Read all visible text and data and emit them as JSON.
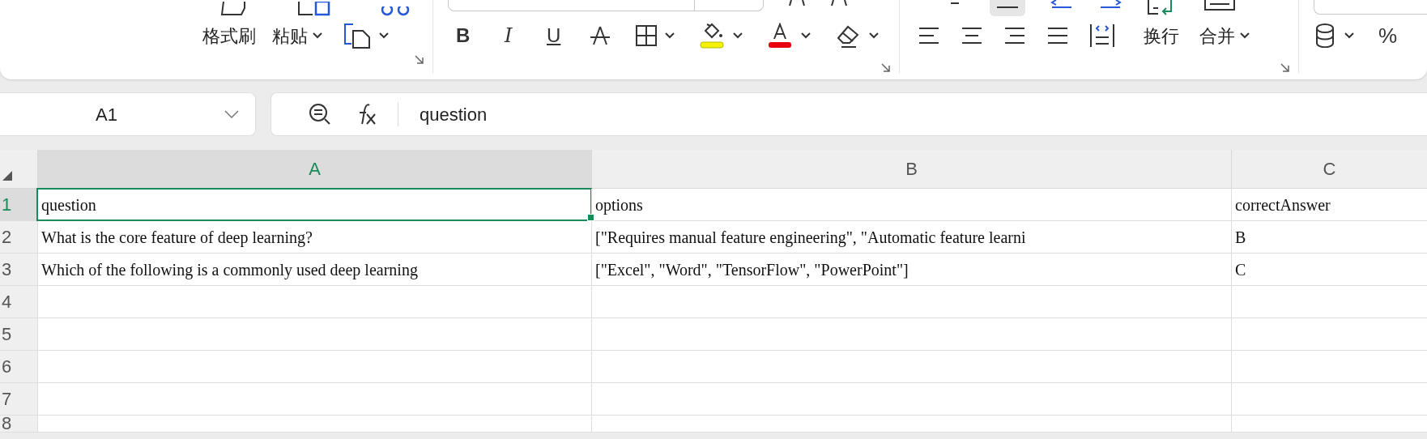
{
  "toolbar": {
    "clipboard_buttons": [
      {
        "label": "格式刷",
        "dropdown": false
      },
      {
        "label": "粘贴",
        "dropdown": true
      }
    ],
    "format_buttons": [
      "B",
      "I",
      "U"
    ],
    "alignment_buttons": [
      {
        "label": "换行",
        "dropdown": false
      },
      {
        "label": "合并",
        "dropdown": true
      }
    ],
    "number_buttons": [
      "%"
    ]
  },
  "name_box": {
    "value": "A1"
  },
  "formula_bar": {
    "value": "question"
  },
  "sheet": {
    "columns": [
      {
        "label": "A",
        "selected": true
      },
      {
        "label": "B",
        "selected": false
      },
      {
        "label": "C",
        "selected": false
      }
    ],
    "rows": [
      {
        "number": "1",
        "selected": true,
        "cells": [
          "question",
          "options",
          "correctAnswer"
        ]
      },
      {
        "number": "2",
        "selected": false,
        "cells": [
          "What is the core feature of deep learning?",
          "[\"Requires manual feature engineering\", \"Automatic feature learni",
          "B"
        ]
      },
      {
        "number": "3",
        "selected": false,
        "cells": [
          "Which of the following is a commonly used deep learning",
          "[\"Excel\", \"Word\", \"TensorFlow\", \"PowerPoint\"]",
          "C"
        ]
      },
      {
        "number": "4",
        "selected": false
      },
      {
        "number": "5",
        "selected": false
      },
      {
        "number": "6",
        "selected": false
      },
      {
        "number": "7",
        "selected": false
      },
      {
        "number": "8",
        "selected": false
      }
    ]
  }
}
